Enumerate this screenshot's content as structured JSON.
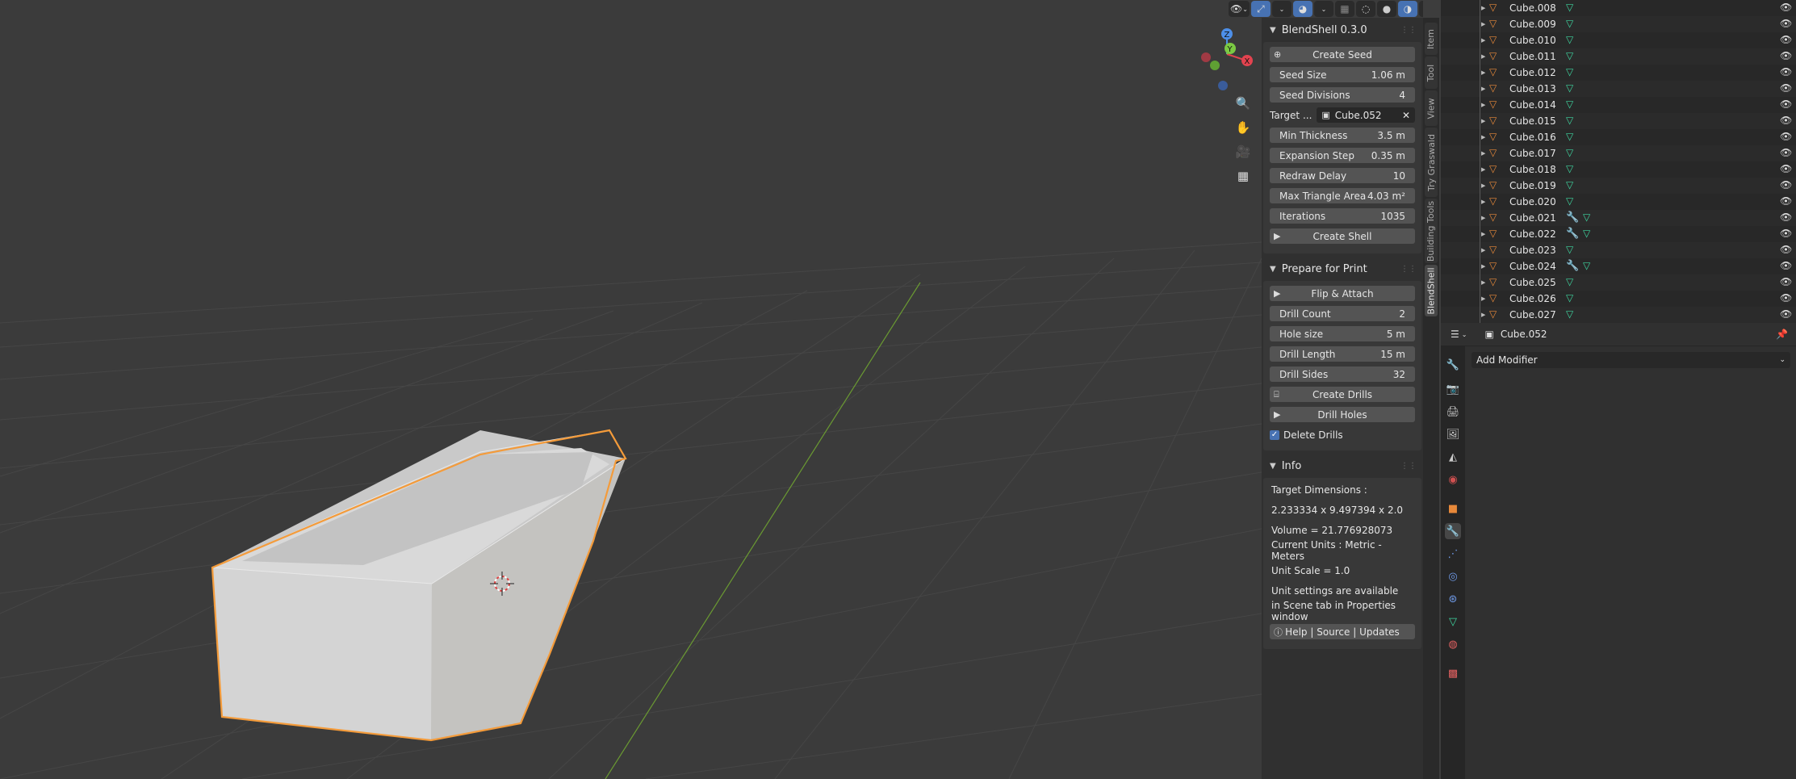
{
  "colors": {
    "accent": "#4772b3",
    "selection": "#f49b3a",
    "x_axis": "#e2434f",
    "y_axis": "#7bc943",
    "z_axis": "#4d8fe8",
    "mesh_icon": "#3ed6a0"
  },
  "viewport": {
    "gizmo": {
      "z": "Z",
      "y": "Y",
      "x": "X"
    },
    "nav_icons": [
      "zoom-icon",
      "hand-pan-icon",
      "camera-icon",
      "grid-ortho-icon"
    ]
  },
  "blendshell": {
    "title": "BlendShell 0.3.0",
    "create_seed": "Create Seed",
    "seed_size": {
      "label": "Seed Size",
      "value": "1.06 m"
    },
    "seed_divisions": {
      "label": "Seed Divisions",
      "value": "4"
    },
    "target": {
      "label": "Target ...",
      "value": "Cube.052"
    },
    "min_thickness": {
      "label": "Min Thickness",
      "value": "3.5 m"
    },
    "expansion_step": {
      "label": "Expansion Step",
      "value": "0.35 m"
    },
    "redraw_delay": {
      "label": "Redraw Delay",
      "value": "10"
    },
    "max_triangle_area": {
      "label": "Max Triangle Area",
      "value": "4.03 m²"
    },
    "iterations": {
      "label": "Iterations",
      "value": "1035"
    },
    "create_shell": "Create Shell"
  },
  "prepare": {
    "title": "Prepare for Print",
    "flip_attach": "Flip & Attach",
    "drill_count": {
      "label": "Drill Count",
      "value": "2"
    },
    "hole_size": {
      "label": "Hole size",
      "value": "5 m"
    },
    "drill_length": {
      "label": "Drill Length",
      "value": "15 m"
    },
    "drill_sides": {
      "label": "Drill Sides",
      "value": "32"
    },
    "create_drills": "Create Drills",
    "drill_holes": "Drill Holes",
    "delete_drills": "Delete Drills",
    "delete_drills_checked": true
  },
  "info": {
    "title": "Info",
    "lines": [
      "Target Dimensions :",
      "2.233334 x 9.497394 x 2.0",
      "Volume = 21.776928073",
      "Current Units : Metric - Meters",
      "Unit Scale = 1.0",
      "Unit settings are available",
      "in Scene tab in Properties window"
    ],
    "help": "Help | Source | Updates"
  },
  "tabs": [
    "Item",
    "Tool",
    "View",
    "Try Graswald",
    "Building Tools",
    "BlendShell"
  ],
  "active_tab": "BlendShell",
  "outliner": {
    "items": [
      {
        "name": "Cube.008",
        "modifier": false
      },
      {
        "name": "Cube.009",
        "modifier": false
      },
      {
        "name": "Cube.010",
        "modifier": false
      },
      {
        "name": "Cube.011",
        "modifier": false
      },
      {
        "name": "Cube.012",
        "modifier": false
      },
      {
        "name": "Cube.013",
        "modifier": false
      },
      {
        "name": "Cube.014",
        "modifier": false
      },
      {
        "name": "Cube.015",
        "modifier": false
      },
      {
        "name": "Cube.016",
        "modifier": false
      },
      {
        "name": "Cube.017",
        "modifier": false
      },
      {
        "name": "Cube.018",
        "modifier": false
      },
      {
        "name": "Cube.019",
        "modifier": false
      },
      {
        "name": "Cube.020",
        "modifier": false
      },
      {
        "name": "Cube.021",
        "modifier": true
      },
      {
        "name": "Cube.022",
        "modifier": true
      },
      {
        "name": "Cube.023",
        "modifier": false
      },
      {
        "name": "Cube.024",
        "modifier": true
      },
      {
        "name": "Cube.025",
        "modifier": false
      },
      {
        "name": "Cube.026",
        "modifier": false
      },
      {
        "name": "Cube.027",
        "modifier": false
      }
    ]
  },
  "properties": {
    "object_name": "Cube.052",
    "add_modifier": "Add Modifier"
  }
}
